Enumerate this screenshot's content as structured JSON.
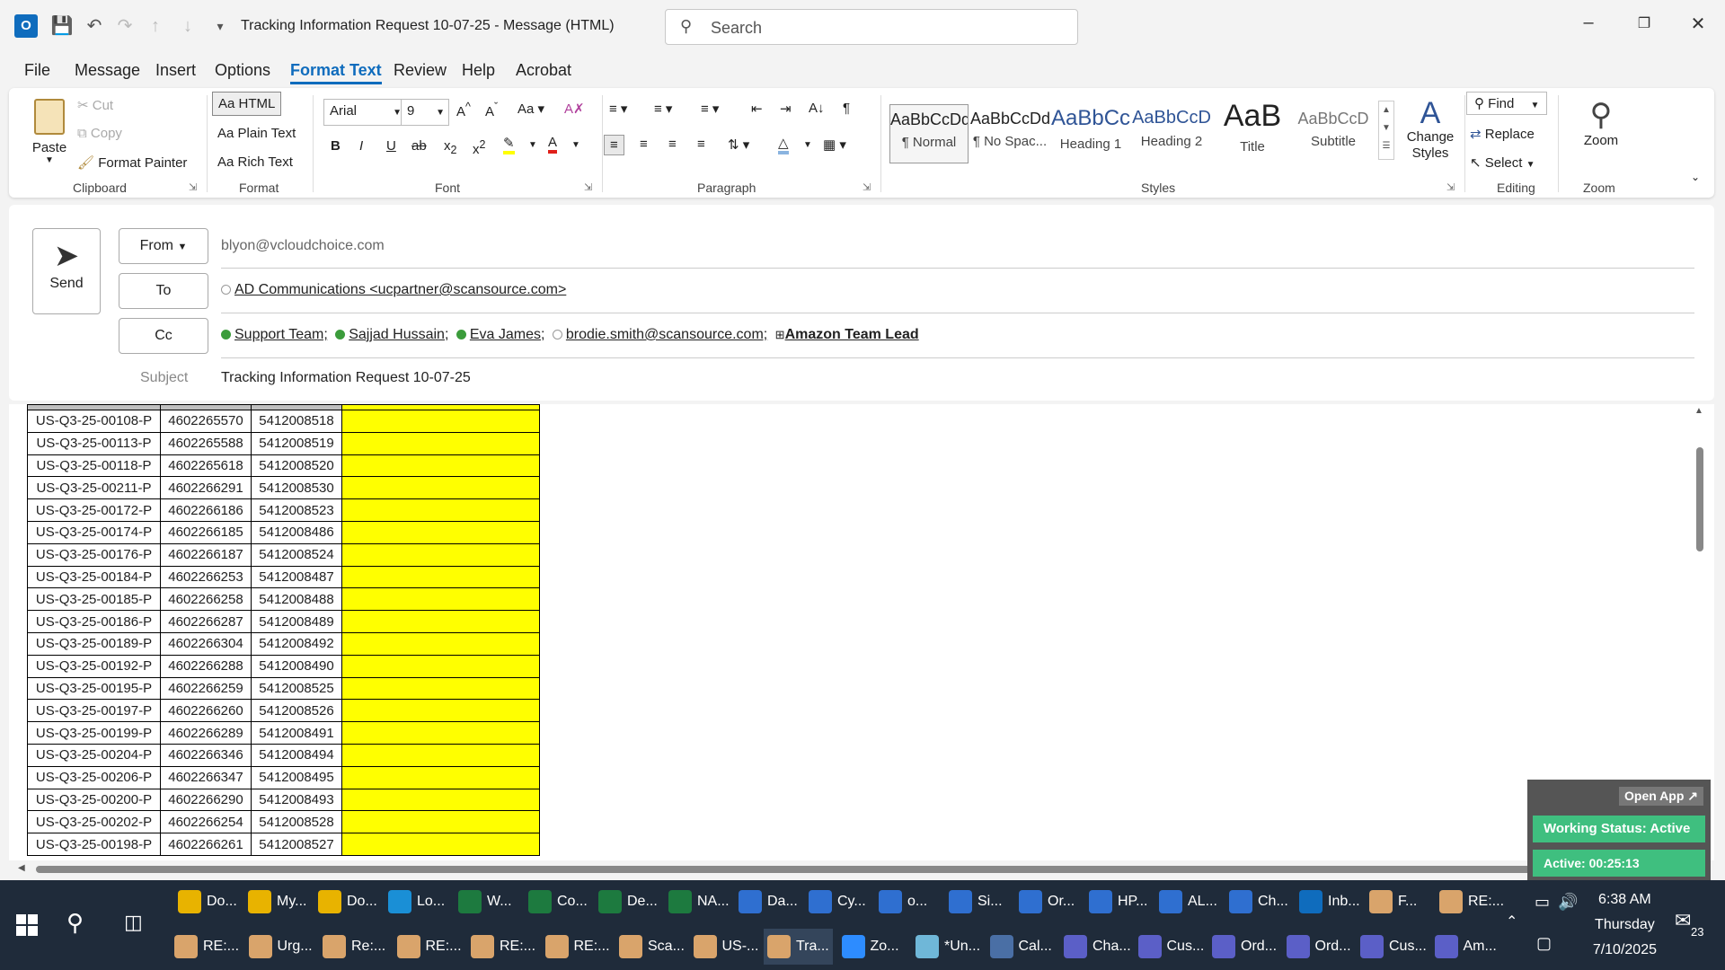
{
  "window": {
    "title": "Tracking Information Request  10-07-25  -  Message (HTML)",
    "search_placeholder": "Search"
  },
  "menu_tabs": [
    "File",
    "Message",
    "Insert",
    "Options",
    "Format Text",
    "Review",
    "Help",
    "Acrobat"
  ],
  "ribbon": {
    "clipboard": {
      "paste": "Paste",
      "cut": "Cut",
      "copy": "Copy",
      "format_painter": "Format Painter",
      "label": "Clipboard"
    },
    "format": {
      "html": "Aa HTML",
      "plain": "Aa Plain Text",
      "rich": "Aa Rich Text",
      "label": "Format"
    },
    "font": {
      "name": "Arial",
      "size": "9",
      "label": "Font"
    },
    "paragraph": {
      "label": "Paragraph"
    },
    "styles": {
      "tiles": [
        {
          "sample": "AaBbCcDd",
          "name": "¶ Normal"
        },
        {
          "sample": "AaBbCcDd",
          "name": "¶ No Spac..."
        },
        {
          "sample": "AaBbCc",
          "name": "Heading 1"
        },
        {
          "sample": "AaBbCcD",
          "name": "Heading 2"
        },
        {
          "sample": "AaB",
          "name": "Title"
        },
        {
          "sample": "AaBbCcD",
          "name": "Subtitle"
        }
      ],
      "change_styles": "Change Styles",
      "label": "Styles"
    },
    "editing": {
      "find": "Find",
      "replace": "Replace",
      "select": "Select",
      "label": "Editing"
    },
    "zoom": {
      "zoom": "Zoom",
      "label": "Zoom"
    }
  },
  "compose": {
    "send": "Send",
    "from_label": "From",
    "from_value": "blyon@vcloudchoice.com",
    "to_label": "To",
    "to_value": "AD Communications <ucpartner@scansource.com>",
    "cc_label": "Cc",
    "cc": [
      {
        "name": "Support Team;",
        "status": "ok"
      },
      {
        "name": "Sajjad Hussain;",
        "status": "ok"
      },
      {
        "name": "Eva James;",
        "status": "ok"
      },
      {
        "name": "brodie.smith@scansource.com;",
        "status": "off"
      },
      {
        "name": "Amazon Team Lead",
        "status": "group"
      }
    ],
    "subject_label": "Subject",
    "subject_value": "Tracking Information Request  10-07-25"
  },
  "table_rows": [
    [
      "US-Q3-25-00108-P",
      "4602265570",
      "5412008518"
    ],
    [
      "US-Q3-25-00113-P",
      "4602265588",
      "5412008519"
    ],
    [
      "US-Q3-25-00118-P",
      "4602265618",
      "5412008520"
    ],
    [
      "US-Q3-25-00211-P",
      "4602266291",
      "5412008530"
    ],
    [
      "US-Q3-25-00172-P",
      "4602266186",
      "5412008523"
    ],
    [
      "US-Q3-25-00174-P",
      "4602266185",
      "5412008486"
    ],
    [
      "US-Q3-25-00176-P",
      "4602266187",
      "5412008524"
    ],
    [
      "US-Q3-25-00184-P",
      "4602266253",
      "5412008487"
    ],
    [
      "US-Q3-25-00185-P",
      "4602266258",
      "5412008488"
    ],
    [
      "US-Q3-25-00186-P",
      "4602266287",
      "5412008489"
    ],
    [
      "US-Q3-25-00189-P",
      "4602266304",
      "5412008492"
    ],
    [
      "US-Q3-25-00192-P",
      "4602266288",
      "5412008490"
    ],
    [
      "US-Q3-25-00195-P",
      "4602266259",
      "5412008525"
    ],
    [
      "US-Q3-25-00197-P",
      "4602266260",
      "5412008526"
    ],
    [
      "US-Q3-25-00199-P",
      "4602266289",
      "5412008491"
    ],
    [
      "US-Q3-25-00204-P",
      "4602266346",
      "5412008494"
    ],
    [
      "US-Q3-25-00206-P",
      "4602266347",
      "5412008495"
    ],
    [
      "US-Q3-25-00200-P",
      "4602266290",
      "5412008493"
    ],
    [
      "US-Q3-25-00202-P",
      "4602266254",
      "5412008528"
    ],
    [
      "US-Q3-25-00198-P",
      "4602266261",
      "5412008527"
    ]
  ],
  "widget": {
    "open_app": "Open App ↗",
    "status": "Working Status: Active",
    "active": "Active: 00:25:13"
  },
  "taskbar": {
    "row1": [
      {
        "label": "Do...",
        "icon": "folder-icon",
        "color": "#e8b300"
      },
      {
        "label": "My...",
        "icon": "folder-icon",
        "color": "#e8b300"
      },
      {
        "label": "Do...",
        "icon": "folder-icon",
        "color": "#e8b300"
      },
      {
        "label": "Lo...",
        "icon": "edge-icon",
        "color": "#1a8fd6"
      },
      {
        "label": "W...",
        "icon": "excel-icon",
        "color": "#1d7a3f"
      },
      {
        "label": "Co...",
        "icon": "excel-icon",
        "color": "#1d7a3f"
      },
      {
        "label": "De...",
        "icon": "excel-icon",
        "color": "#1d7a3f"
      },
      {
        "label": "NA...",
        "icon": "excel-icon",
        "color": "#1d7a3f"
      },
      {
        "label": "Da...",
        "icon": "chrome-icon",
        "color": "#2f6fd0"
      },
      {
        "label": "Cy...",
        "icon": "chrome-icon",
        "color": "#2f6fd0"
      },
      {
        "label": "o...",
        "icon": "chrome-icon",
        "color": "#2f6fd0"
      },
      {
        "label": "Si...",
        "icon": "chrome-icon",
        "color": "#2f6fd0"
      },
      {
        "label": "Or...",
        "icon": "chrome-icon",
        "color": "#2f6fd0"
      },
      {
        "label": "HP...",
        "icon": "chrome-icon",
        "color": "#2f6fd0"
      },
      {
        "label": "AL...",
        "icon": "chrome-icon",
        "color": "#2f6fd0"
      },
      {
        "label": "Ch...",
        "icon": "chrome-icon",
        "color": "#2f6fd0"
      },
      {
        "label": "Inb...",
        "icon": "outlook-icon",
        "color": "#0f6cbd"
      },
      {
        "label": "F...",
        "icon": "mail-icon",
        "color": "#d9a46b"
      },
      {
        "label": "RE:...",
        "icon": "mail-icon",
        "color": "#d9a46b"
      }
    ],
    "row2": [
      {
        "label": "RE:...",
        "icon": "mail-icon",
        "color": "#d9a46b"
      },
      {
        "label": "Urg...",
        "icon": "mail-icon",
        "color": "#d9a46b"
      },
      {
        "label": "Re:...",
        "icon": "mail-icon",
        "color": "#d9a46b"
      },
      {
        "label": "RE:...",
        "icon": "mail-icon",
        "color": "#d9a46b"
      },
      {
        "label": "RE:...",
        "icon": "mail-icon",
        "color": "#d9a46b"
      },
      {
        "label": "RE:...",
        "icon": "mail-icon",
        "color": "#d9a46b"
      },
      {
        "label": "Sca...",
        "icon": "mail-icon",
        "color": "#d9a46b"
      },
      {
        "label": "US-...",
        "icon": "mail-icon",
        "color": "#d9a46b"
      },
      {
        "label": "Tra...",
        "icon": "mail-compose-icon",
        "color": "#d9a46b"
      },
      {
        "label": "Zo...",
        "icon": "zoom-icon",
        "color": "#2d8cff"
      },
      {
        "label": "*Un...",
        "icon": "notepad-icon",
        "color": "#6fb7d8"
      },
      {
        "label": "Cal...",
        "icon": "calculator-icon",
        "color": "#4a6fa5"
      },
      {
        "label": "Cha...",
        "icon": "teams-icon",
        "color": "#5b5fc7"
      },
      {
        "label": "Cus...",
        "icon": "teams-icon",
        "color": "#5b5fc7"
      },
      {
        "label": "Ord...",
        "icon": "teams-icon",
        "color": "#5b5fc7"
      },
      {
        "label": "Ord...",
        "icon": "teams-icon",
        "color": "#5b5fc7"
      },
      {
        "label": "Cus...",
        "icon": "teams-icon",
        "color": "#5b5fc7"
      },
      {
        "label": "Am...",
        "icon": "teams-icon",
        "color": "#5b5fc7"
      }
    ],
    "time": "6:38 AM",
    "day": "Thursday",
    "date": "7/10/2025",
    "notification_count": "23"
  }
}
